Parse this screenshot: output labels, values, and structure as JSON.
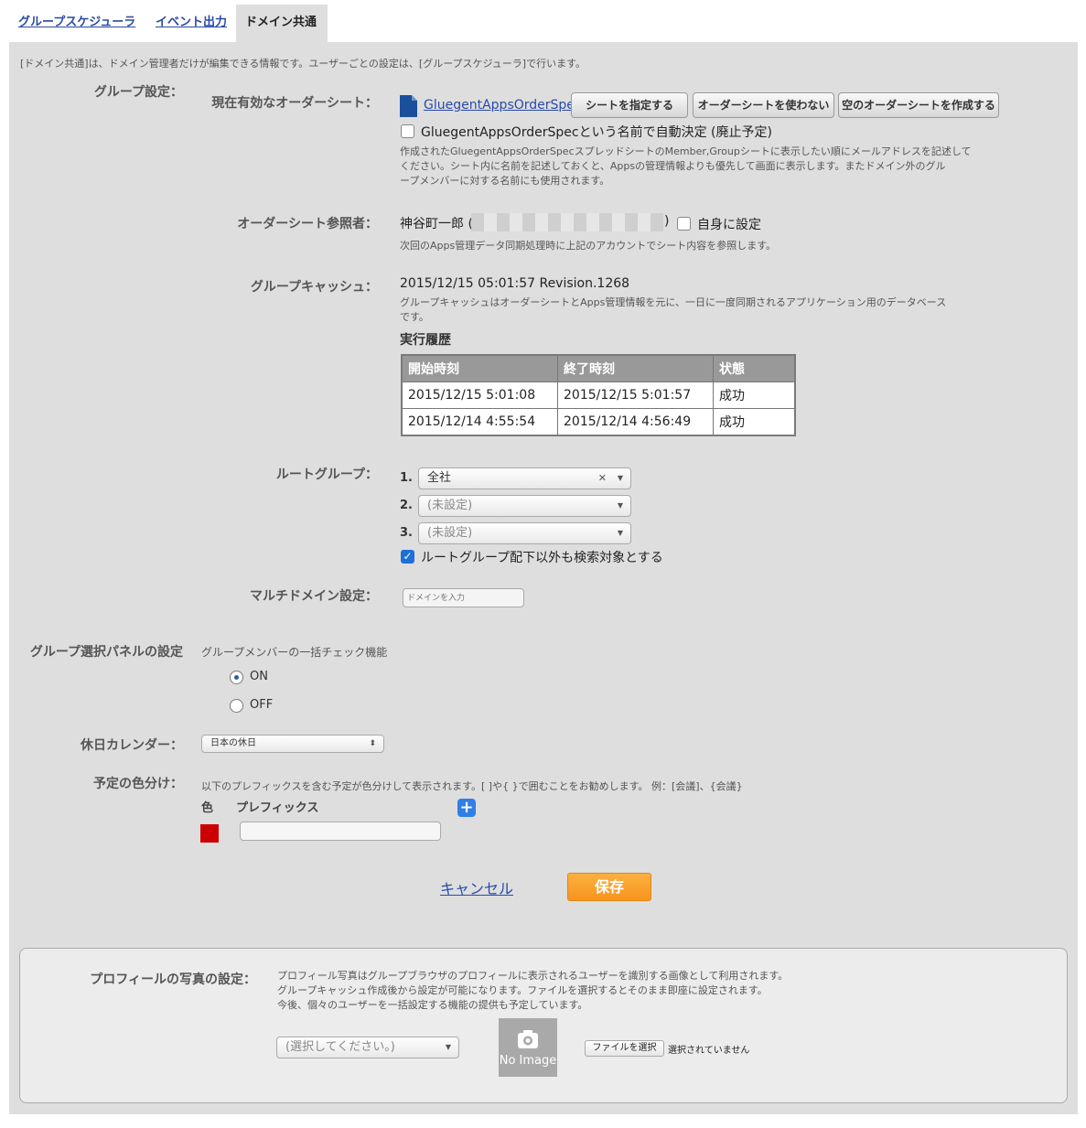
{
  "tabs": [
    {
      "label": "グループスケジューラ"
    },
    {
      "label": "イベント出力"
    },
    {
      "label": "ドメイン共通"
    }
  ],
  "intro_text": "[ドメイン共通]は、ドメイン管理者だけが編集できる情報です。ユーザーごとの設定は、[グループスケジューラ]で行います。",
  "group_settings": {
    "label": "グループ設定：",
    "order_sheet": {
      "label": "現在有効なオーダーシート：",
      "link_text": "GluegentAppsOrderSpec",
      "buttons": [
        "シートを指定する",
        "オーダーシートを使わない",
        "空のオーダーシートを作成する"
      ],
      "auto_checkbox_label": "GluegentAppsOrderSpecという名前で自動決定 (廃止予定)",
      "auto_checked": false,
      "description_lines": [
        "作成されたGluegentAppsOrderSpecスプレッドシートのMember,Groupシートに表示したい順にメールアドレスを記述して",
        "ください。シート内に名前を記述しておくと、Appsの管理情報よりも優先して画面に表示します。またドメイン外のグル",
        "ープメンバーに対する名前にも使用されます。"
      ]
    },
    "reference_user": {
      "label": "オーダーシート参照者：",
      "name_prefix": "神谷町一郎 (",
      "name_suffix": ")",
      "self_checkbox_label": "自身に設定",
      "self_checked": false,
      "note": "次回のApps管理データ同期処理時に上記のアカウントでシート内容を参照します。"
    },
    "group_cache": {
      "label": "グループキャッシュ：",
      "value": "2015/12/15 05:01:57 Revision.1268",
      "description_lines": [
        "グループキャッシュはオーダーシートとApps管理情報を元に、一日に一度同期されるアプリケーション用のデータベース",
        "です。"
      ],
      "history_title": "実行履歴",
      "columns": [
        "開始時刻",
        "終了時刻",
        "状態"
      ],
      "rows": [
        [
          "2015/12/15 5:01:08",
          "2015/12/15 5:01:57",
          "成功"
        ],
        [
          "2015/12/14 4:55:54",
          "2015/12/14 4:56:49",
          "成功"
        ]
      ]
    },
    "root_group": {
      "label": "ルートグループ：",
      "items": [
        {
          "num": "1.",
          "value": "全社",
          "clear": "✕"
        },
        {
          "num": "2.",
          "value": "(未設定)"
        },
        {
          "num": "3.",
          "value": "(未設定)"
        }
      ],
      "search_checkbox_label": "ルートグループ配下以外も検索対象とする",
      "search_checked": true
    },
    "multi_domain": {
      "label": "マルチドメイン設定：",
      "placeholder": "ドメインを入力"
    }
  },
  "group_panel": {
    "label": "グループ選択パネルの設定",
    "sublabel": "グループメンバーの一括チェック機能",
    "options": [
      {
        "label": "ON",
        "selected": true
      },
      {
        "label": "OFF",
        "selected": false
      }
    ]
  },
  "holiday_calendar": {
    "label": "休日カレンダー：",
    "value": "日本の休日"
  },
  "color_coding": {
    "label": "予定の色分け：",
    "description": "以下のプレフィックスを含む予定が色分けして表示されます。[ ]や{ }で囲むことをお勧めします。 例：[会議]、{会議}",
    "col_color": "色",
    "col_prefix": "プレフィックス",
    "add_symbol": "+",
    "row_color": "#cc0000",
    "row_prefix": ""
  },
  "actions": {
    "cancel": "キャンセル",
    "save": "保存"
  },
  "profile_photo": {
    "label": "プロフィールの写真の設定：",
    "description_lines": [
      "プロフィール写真はグループブラウザのプロフィールに表示されるユーザーを識別する画像として利用されます。",
      "グループキャッシュ作成後から設定が可能になります。ファイルを選択するとそのまま即座に設定されます。",
      "今後、個々のユーザーを一括設定する機能の提供も予定しています。"
    ],
    "select_placeholder": "(選択してください。)",
    "no_image": "No Image",
    "file_button": "ファイルを選択",
    "file_status": "選択されていません"
  },
  "colors": {
    "save_button": "#f7941d",
    "link": "#2a4aa8"
  }
}
